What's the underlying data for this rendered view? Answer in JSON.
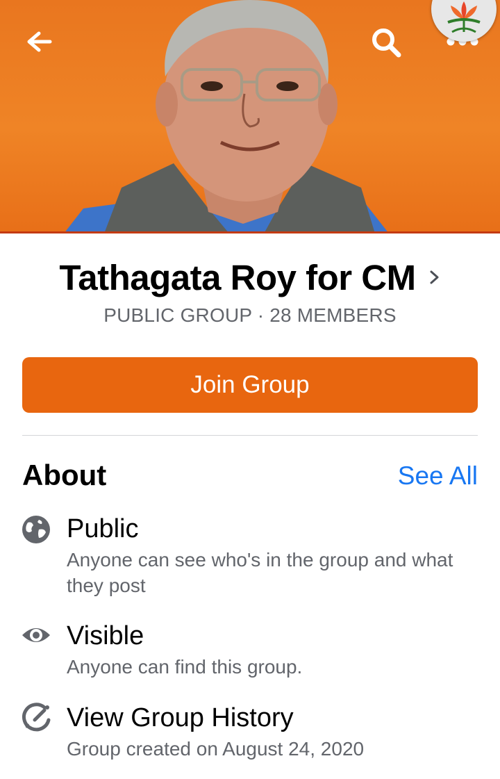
{
  "header": {
    "back_icon": "arrow-left-icon",
    "search_icon": "search-icon",
    "more_icon": "more-horizontal-icon",
    "cover_photo": "portrait-photo",
    "badge": "lotus-emblem"
  },
  "group": {
    "title": "Tathagata Roy for CM",
    "subtitle": "PUBLIC GROUP · 28 MEMBERS",
    "join_label": "Join Group"
  },
  "about": {
    "heading": "About",
    "see_all": "See All",
    "items": [
      {
        "icon": "globe-icon",
        "title": "Public",
        "desc": "Anyone can see who's in the group and what they post"
      },
      {
        "icon": "eye-icon",
        "title": "Visible",
        "desc": "Anyone can find this group."
      },
      {
        "icon": "history-icon",
        "title": "View Group History",
        "desc": "Group created on August 24, 2020"
      }
    ]
  },
  "colors": {
    "accent": "#e8660f",
    "link": "#1877f2",
    "secondary_text": "#62656b"
  }
}
